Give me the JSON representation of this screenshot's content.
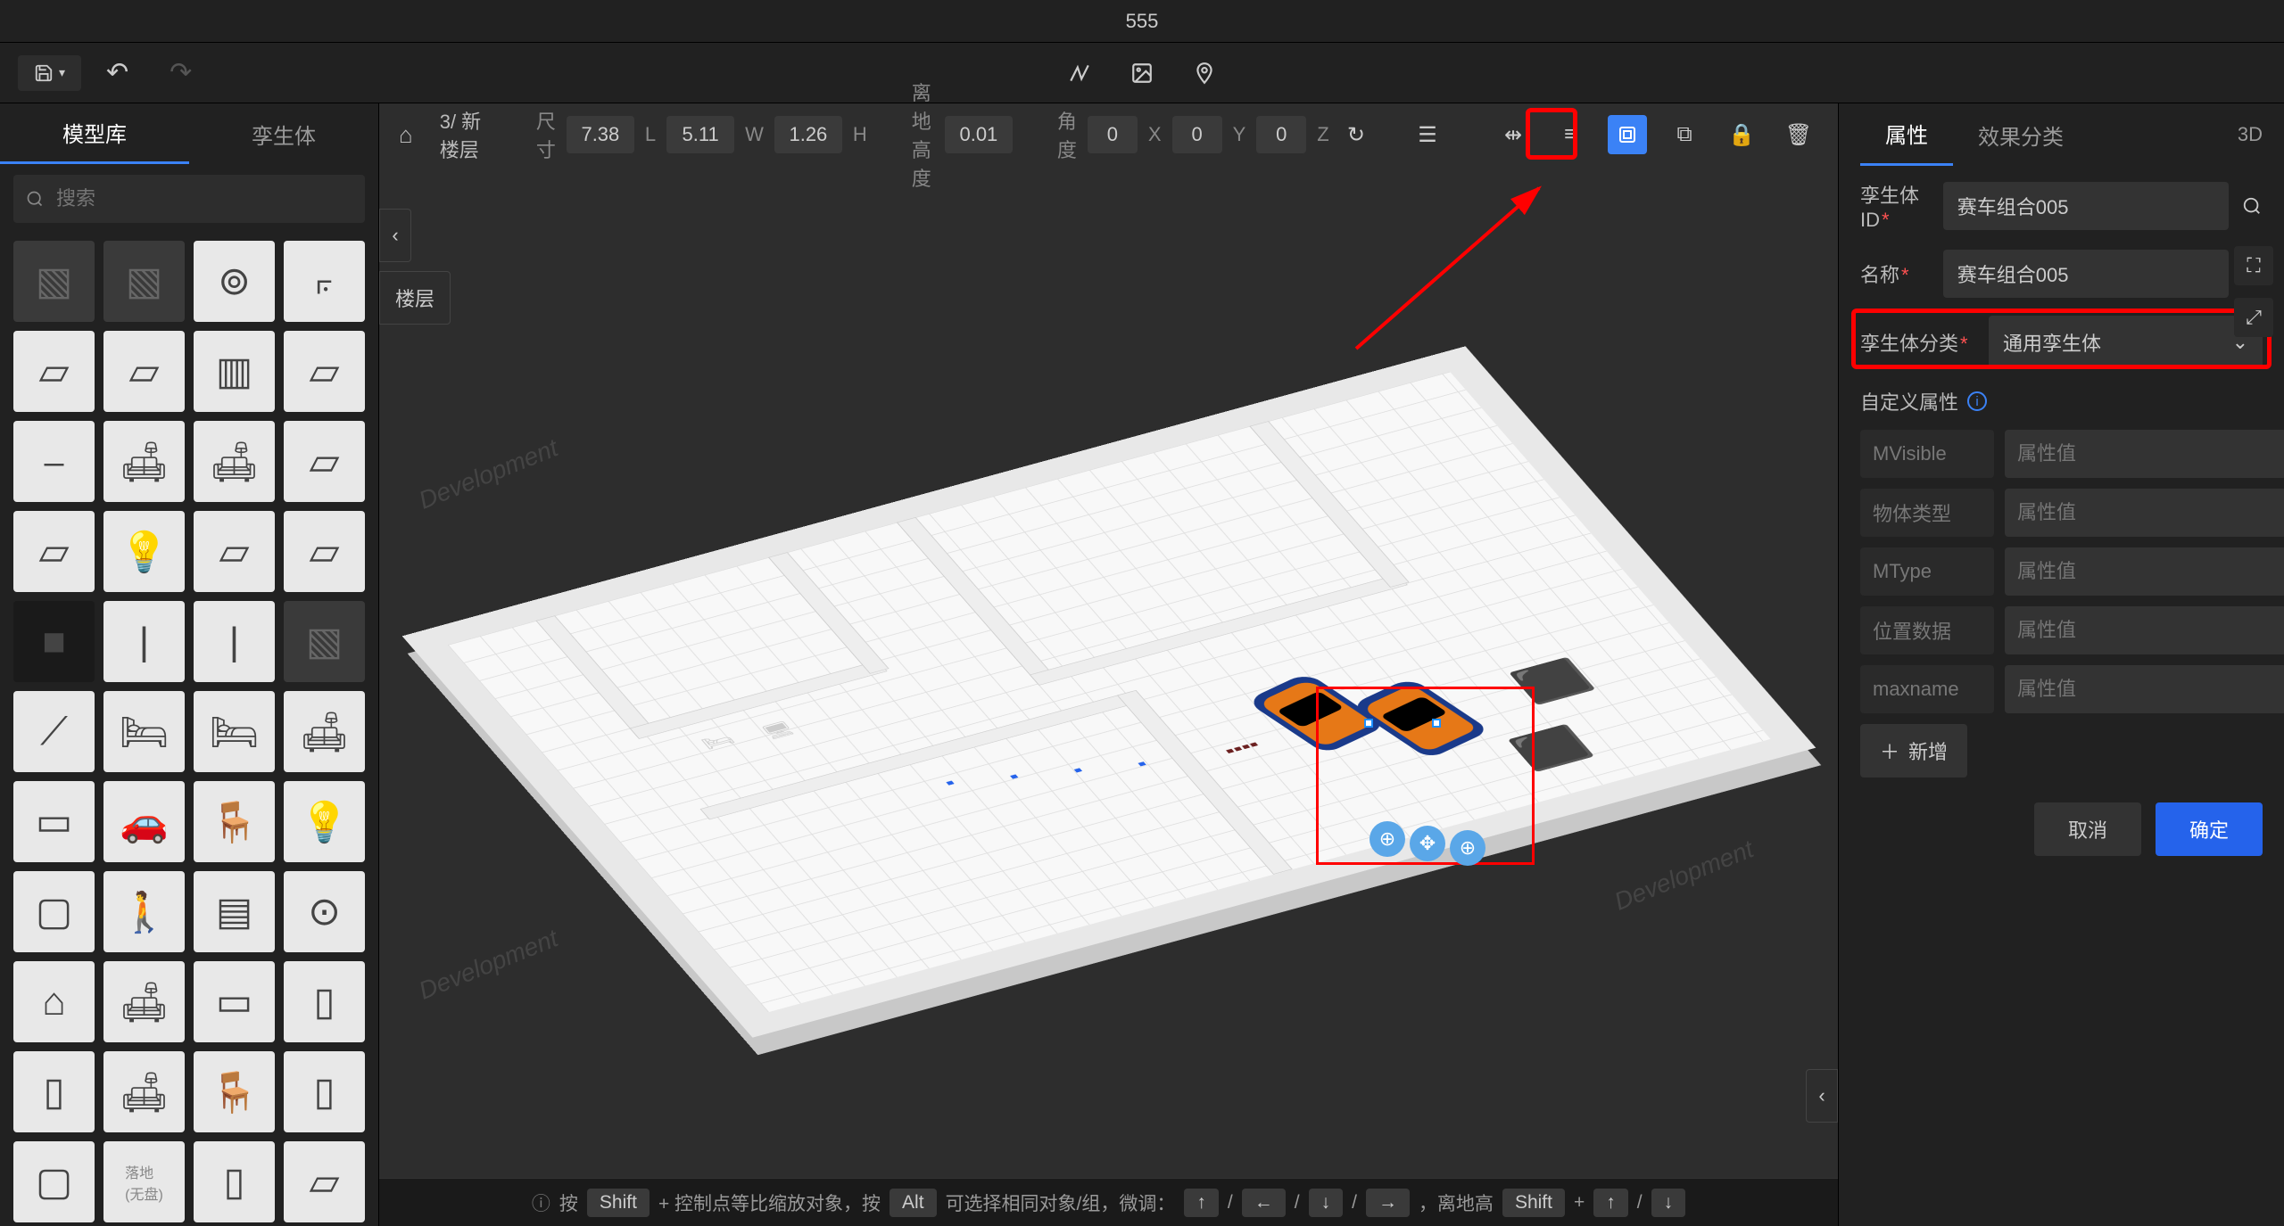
{
  "title": "555",
  "left_tabs": {
    "models": "模型库",
    "twins": "孪生体"
  },
  "search_placeholder": "搜索",
  "floor_label": "3/ 新楼层",
  "layer_label": "楼层",
  "dims": {
    "size_label": "尺寸",
    "L": "7.38",
    "L_unit": "L",
    "W": "5.11",
    "W_unit": "W",
    "H": "1.26",
    "H_unit": "H",
    "ground_label": "离地高度",
    "ground": "0.01",
    "angle_label": "角度",
    "X": "0",
    "X_unit": "X",
    "Y": "0",
    "Y_unit": "Y",
    "Z": "0",
    "Z_unit": "Z"
  },
  "right": {
    "tab_attr": "属性",
    "tab_effect": "效果分类",
    "three_d": "3D",
    "twin_id_label": "孪生体ID",
    "twin_id_value": "赛车组合005",
    "name_label": "名称",
    "name_value": "赛车组合005",
    "category_label": "孪生体分类",
    "category_value": "通用孪生体",
    "custom_title": "自定义属性",
    "custom": [
      {
        "key": "MVisible",
        "placeholder": "属性值"
      },
      {
        "key": "物体类型",
        "placeholder": "属性值"
      },
      {
        "key": "MType",
        "placeholder": "属性值"
      },
      {
        "key": "位置数据",
        "placeholder": "属性值"
      },
      {
        "key": "maxname",
        "placeholder": "属性值"
      }
    ],
    "add_label": "新增",
    "cancel": "取消",
    "ok": "确定"
  },
  "status": {
    "prefix": "按",
    "shift": "Shift",
    "shift_tip": "+ 控制点等比缩放对象，按",
    "alt": "Alt",
    "alt_tip": "可选择相同对象/组，微调：",
    "ground_label": "，离地高",
    "keys": [
      "↑",
      "/",
      "←",
      "/",
      "↓",
      "/",
      "→"
    ],
    "ground_keys": [
      "Shift",
      "+",
      "↑",
      "/",
      "↓"
    ]
  },
  "watermark": "Development"
}
